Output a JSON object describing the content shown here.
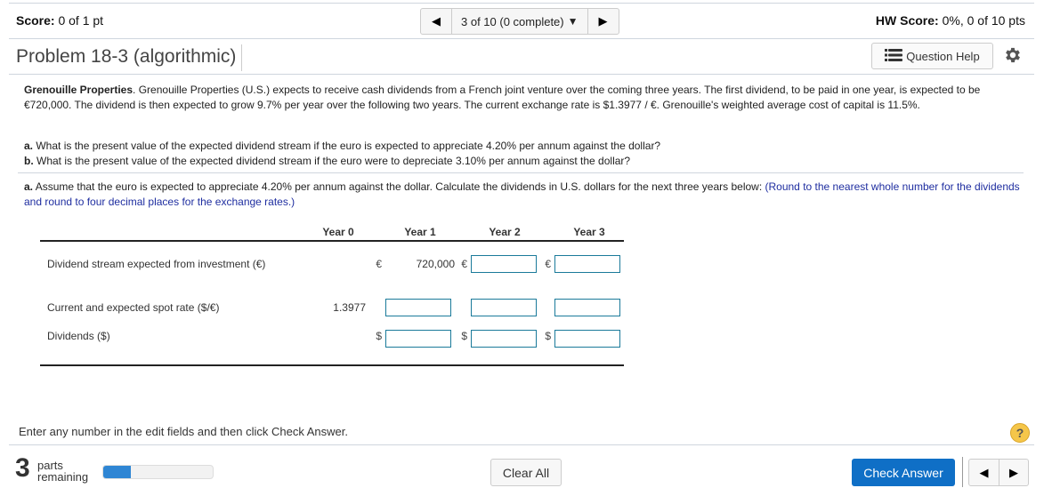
{
  "header": {
    "score_label": "Score:",
    "score_value": "0 of 1 pt",
    "nav_prev_icon": "◀",
    "nav_position": "3 of 10 (0 complete)",
    "nav_dropdown_icon": "▼",
    "nav_next_icon": "▶",
    "hw_score_label": "HW Score:",
    "hw_score_value": "0%, 0 of 10 pts"
  },
  "problem": {
    "title": "Problem 18-3 (algorithmic)",
    "question_help_label": "Question Help",
    "company_bold": "Grenouille Properties",
    "description": ". Grenouille Properties (U.S.) expects to receive cash dividends from a French joint venture over the coming three years. The first dividend, to be paid in one year, is expected to be €720,000. The dividend is then expected to grow 9.7% per year over the following two years. The current exchange rate is $1.3977 / €. Grenouille's weighted average cost of capital is 11.5%.",
    "questions": [
      {
        "letter": "a.",
        "text": " What is the present value of the expected dividend stream if the euro is expected to appreciate 4.20% per annum against the dollar?"
      },
      {
        "letter": "b.",
        "text": " What is the present value of the expected dividend stream if the euro were to depreciate 3.10% per annum against the dollar?"
      }
    ],
    "part_a_letter": "a.",
    "part_a_text": " Assume that the euro is expected to appreciate 4.20% per annum against the dollar. Calculate the dividends in U.S. dollars for the next three years below: ",
    "part_a_hint": "(Round to the nearest whole number for the dividends and round to four decimal places for the exchange rates.)"
  },
  "table": {
    "headers": [
      "Year 0",
      "Year 1",
      "Year 2",
      "Year 3"
    ],
    "rows": [
      {
        "label": "Dividend stream expected from investment (€)",
        "year0_symbol": "€",
        "year1_value": "720,000",
        "year2_symbol": "€",
        "year3_symbol": "€",
        "year2_value": "",
        "year3_value": ""
      },
      {
        "label": "Current and expected spot rate ($/€)",
        "year0_value": "1.3977",
        "year1_value": "",
        "year2_value": "",
        "year3_value": ""
      },
      {
        "label": "Dividends ($)",
        "year1_symbol": "$",
        "year2_symbol": "$",
        "year3_symbol": "$",
        "year1_value": "",
        "year2_value": "",
        "year3_value": ""
      }
    ]
  },
  "footer": {
    "instruction": "Enter any number in the edit fields and then click Check Answer.",
    "help_icon": "?",
    "parts_count": "3",
    "parts_label_1": "parts",
    "parts_label_2": "remaining",
    "progress_fraction": 0.25,
    "clear_all_label": "Clear All",
    "check_answer_label": "Check Answer",
    "prev_icon": "◀",
    "next_icon": "▶"
  },
  "colors": {
    "primary_button": "#0f6fc6",
    "progress_fill": "#2f86d4",
    "hint_text": "#1f2ea0",
    "input_border": "#1a7a9a",
    "help_icon_bg": "#f5c64a"
  }
}
